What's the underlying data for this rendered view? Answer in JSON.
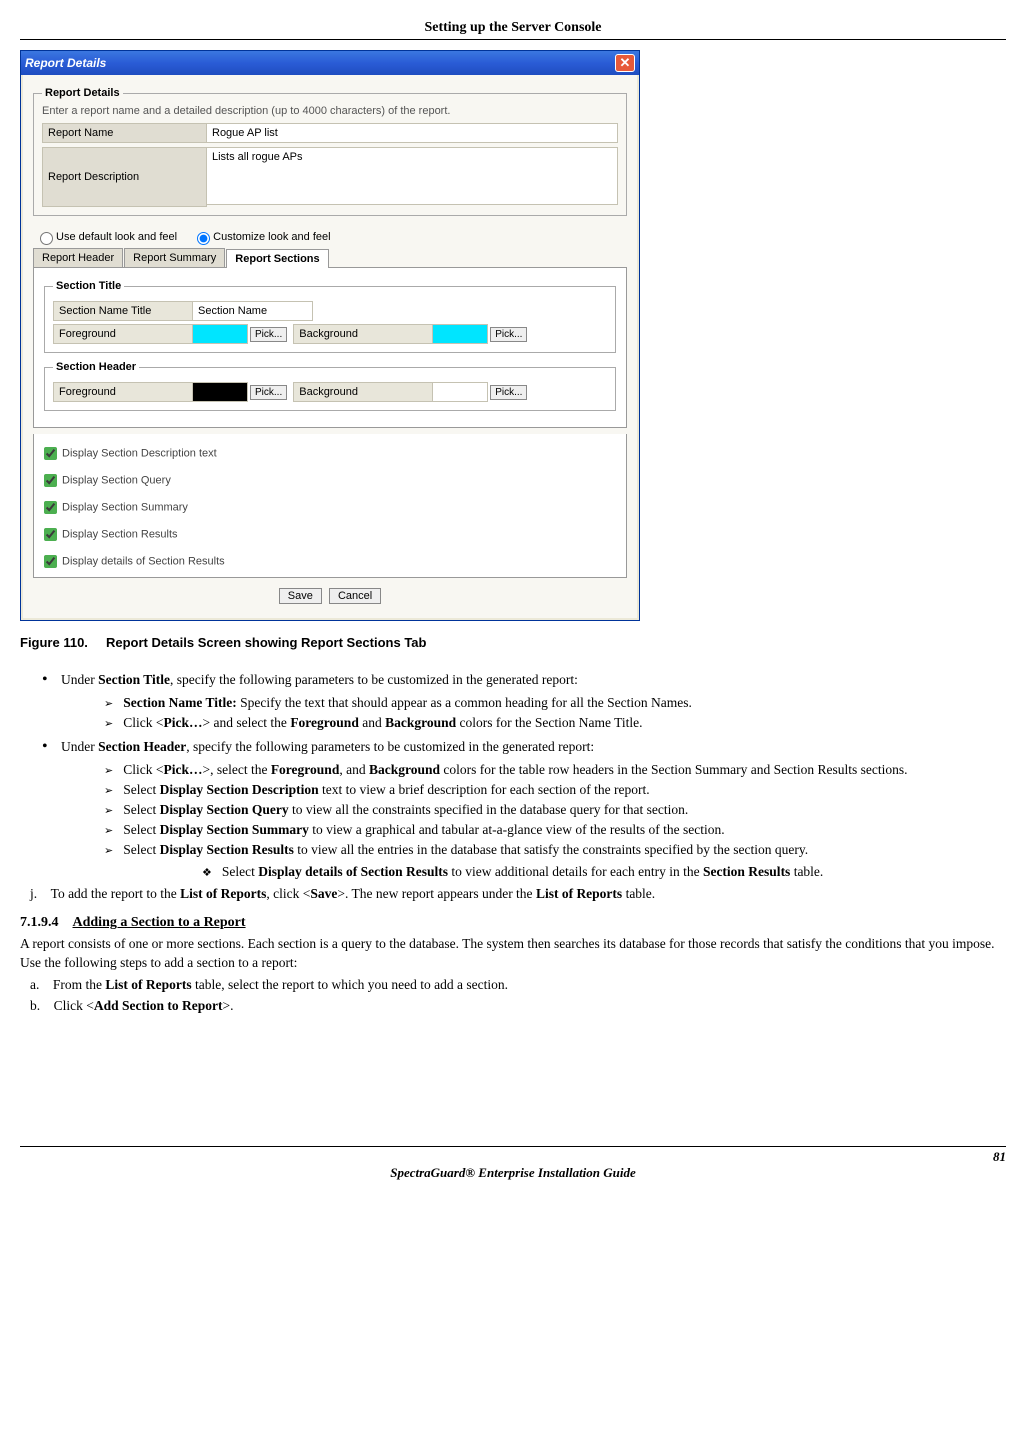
{
  "header": "Setting up the Server Console",
  "dialog": {
    "title": "Report Details",
    "close": "✕",
    "details": {
      "legend": "Report Details",
      "hint": "Enter a report name and a detailed description (up to 4000 characters) of the report.",
      "name_label": "Report Name",
      "name_value": "Rogue AP list",
      "desc_label": "Report Description",
      "desc_value": "Lists all rogue APs"
    },
    "radio": {
      "default": "Use default look and feel",
      "custom": "Customize look and feel"
    },
    "tabs": {
      "header": "Report Header",
      "summary": "Report Summary",
      "sections": "Report Sections"
    },
    "section_title": {
      "legend": "Section Title",
      "name_label": "Section Name Title",
      "name_value": "Section Name",
      "fg_label": "Foreground",
      "bg_label": "Background",
      "pick": "Pick..."
    },
    "section_header": {
      "legend": "Section Header",
      "fg_label": "Foreground",
      "bg_label": "Background",
      "pick": "Pick..."
    },
    "checks": {
      "c1": "Display Section Description text",
      "c2": "Display Section Query",
      "c3": "Display Section Summary",
      "c4": "Display Section Results",
      "c5": "Display details of Section Results"
    },
    "buttons": {
      "save": "Save",
      "cancel": "Cancel"
    }
  },
  "caption": {
    "num": "Figure  110.",
    "text": "Report Details Screen showing Report Sections Tab"
  },
  "content": {
    "b1_pre": "Under ",
    "b1_bold": "Section Title",
    "b1_post": ", specify the following parameters to be customized in the generated report:",
    "a1_bold": "Section Name Title:",
    "a1_text": " Specify the text that should appear as a common heading for all the Section Names.",
    "a2_pre": "Click <",
    "a2_b1": "Pick…",
    "a2_mid": "> and select the ",
    "a2_b2": "Foreground",
    "a2_and": " and ",
    "a2_b3": "Background",
    "a2_post": " colors for the Section Name Title.",
    "b2_pre": "Under ",
    "b2_bold": "Section Header",
    "b2_post": ", specify the following parameters to be customized in the generated report:",
    "a3_pre": "Click <",
    "a3_b1": "Pick…",
    "a3_mid": ">, select the ",
    "a3_b2": "Foreground",
    "a3_mid2": ", and ",
    "a3_b3": "Background",
    "a3_post": " colors for the table row headers in the Section Summary and Section Results sections.",
    "a4_pre": "Select ",
    "a4_bold": "Display Section Description",
    "a4_post": " text to view a brief description for each section of the report.",
    "a5_pre": "Select ",
    "a5_bold": "Display Section Query",
    "a5_post": " to view all the constraints specified in the database query for that section.",
    "a6_pre": "Select ",
    "a6_bold": "Display Section Summary",
    "a6_post": " to view a graphical and tabular at-a-glance view of the results of the section.",
    "a7_pre": "Select ",
    "a7_bold": "Display Section Results",
    "a7_post": " to view all the entries in the database that satisfy the constraints specified by the section query.",
    "d1_pre": "Select ",
    "d1_bold": "Display details of Section Results",
    "d1_mid": " to view additional details for each entry in the ",
    "d1_bold2": "Section Results",
    "d1_post": " table.",
    "j_letter": "j.",
    "j_pre": "To add the report to the ",
    "j_b1": "List of Reports",
    "j_mid": ", click <",
    "j_b2": "Save",
    "j_mid2": ">. The new report appears under the ",
    "j_b3": "List of Reports",
    "j_post": " table.",
    "sec_num": "7.1.9.4",
    "sec_title": "Adding a Section to a Report",
    "para": "A report consists of one or more sections. Each section is a query to the database. The system then searches its database for those records that satisfy the conditions that you impose. Use the following steps to add a section to a report:",
    "la_letter": "a.",
    "la_pre": "From the ",
    "la_bold": "List of Reports",
    "la_post": " table, select the report to which you need to add a section.",
    "lb_letter": "b.",
    "lb_pre": "Click <",
    "lb_bold": "Add Section to Report",
    "lb_post": ">."
  },
  "footer": {
    "page": "81",
    "guide": "SpectraGuard® Enterprise Installation Guide"
  }
}
